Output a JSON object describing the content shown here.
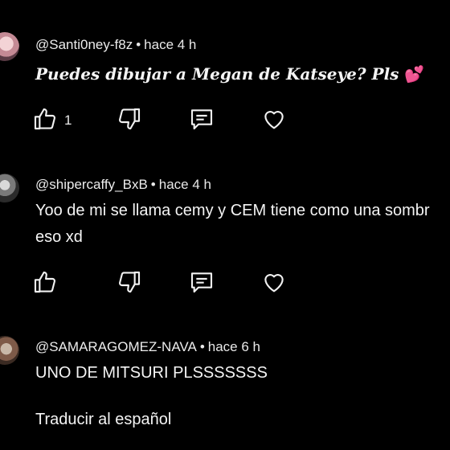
{
  "comments": [
    {
      "handle": "@Santi0ney-f8z",
      "time": "hace 4 h",
      "text": "Puedes dibujar a Megan de Katseye? Pls",
      "emoji": "💕",
      "likes": "1"
    },
    {
      "handle": "@shipercaffy_BxB",
      "time": "hace 4 h",
      "text_line1": "Yoo de mi se llama cemy y CEM tiene como una sombr",
      "text_line2": "eso xd"
    },
    {
      "handle": "@SAMARAGOMEZ-NAVA",
      "time": "hace 6 h",
      "text": "UNO DE MITSURI PLSSSSSSS",
      "translate": "Traducir al español"
    }
  ],
  "separator": "•",
  "icons": [
    "thumbs-up-icon",
    "thumbs-down-icon",
    "reply-icon",
    "heart-icon"
  ],
  "colors": {
    "background": "#000000",
    "text": "#f1f1f1",
    "icon": "#f1f1f1"
  }
}
